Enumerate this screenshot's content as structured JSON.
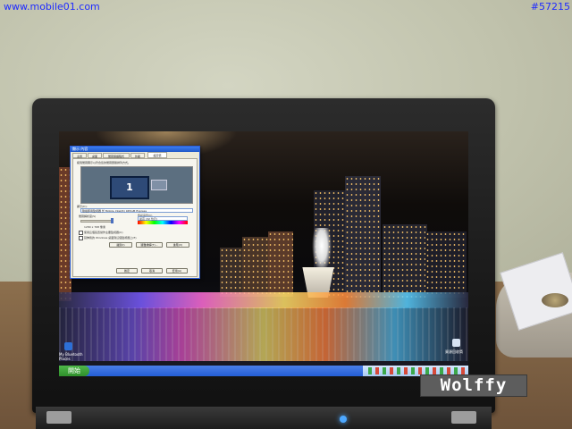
{
  "watermark": {
    "site": "www.mobile01.com",
    "post_id": "#57215",
    "author_badge": "Wolffy"
  },
  "laptop_screen": {
    "wallpaper": "night-city-waterfront",
    "dialog": {
      "title": "顯示 內容",
      "tabs": [
        "主題",
        "桌面",
        "螢幕保護程式",
        "外觀",
        "設定值"
      ],
      "active_tab": "設定值",
      "hint": "拖曳螢幕圖示以符合您的螢幕實體排列方式。",
      "monitor_number": "1",
      "display_label": "顯示(D):",
      "display_value": "隨插即用監視器 於 Mobile Intel(R) 945GM Express",
      "resolution_label": "螢幕解析度(S)",
      "resolution_value": "1280 x 768 像素",
      "color_label": "色彩品質(C)",
      "color_value": "最高 (32 位元)",
      "checkbox_1": "使用這個裝置當作主要監視器(U)",
      "checkbox_2": "延伸我的 Windows 桌面到這個監視器上(E)",
      "buttons": [
        "識別(I)",
        "疑難排解(T)...",
        "進階(V)"
      ],
      "footer_buttons": [
        "確定",
        "取消",
        "套用(A)"
      ]
    },
    "desktop_icons": [
      {
        "icon": "bluetooth-icon",
        "label": "My Bluetooth Places"
      },
      {
        "icon": "recycle-bin-icon",
        "label": "資源回收筒"
      }
    ],
    "taskbar": {
      "start_label": "開始",
      "clock": "下午"
    }
  },
  "colors": {
    "watermark_blue": "#1f2bff",
    "taskbar_blue": "#245ed6",
    "start_green": "#2f8f2b"
  }
}
